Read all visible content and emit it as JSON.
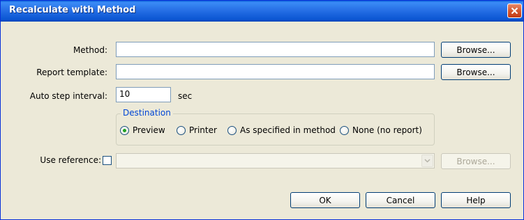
{
  "window": {
    "title": "Recalculate with Method"
  },
  "form": {
    "method": {
      "label": "Method:",
      "value": "",
      "browse_label": "Browse..."
    },
    "report_template": {
      "label": "Report template:",
      "value": "",
      "browse_label": "Browse..."
    },
    "auto_step": {
      "label": "Auto step interval:",
      "value": "10",
      "unit": "sec"
    },
    "destination": {
      "title": "Destination",
      "options": [
        {
          "label": "Preview",
          "selected": true
        },
        {
          "label": "Printer",
          "selected": false
        },
        {
          "label": "As specified in method",
          "selected": false
        },
        {
          "label": "None (no report)",
          "selected": false
        }
      ]
    },
    "use_reference": {
      "label": "Use reference:",
      "checked": false,
      "value": "",
      "browse_label": "Browse..."
    }
  },
  "buttons": {
    "ok": "OK",
    "cancel": "Cancel",
    "help": "Help"
  },
  "colors": {
    "titlebar": "#0a55d2",
    "dialog_bg": "#ece9d8",
    "group_title": "#0046d5",
    "radio_selected": "#21a121",
    "close_button": "#d5582f"
  },
  "icons": {
    "close": "close-icon",
    "dropdown": "chevron-down-icon"
  }
}
